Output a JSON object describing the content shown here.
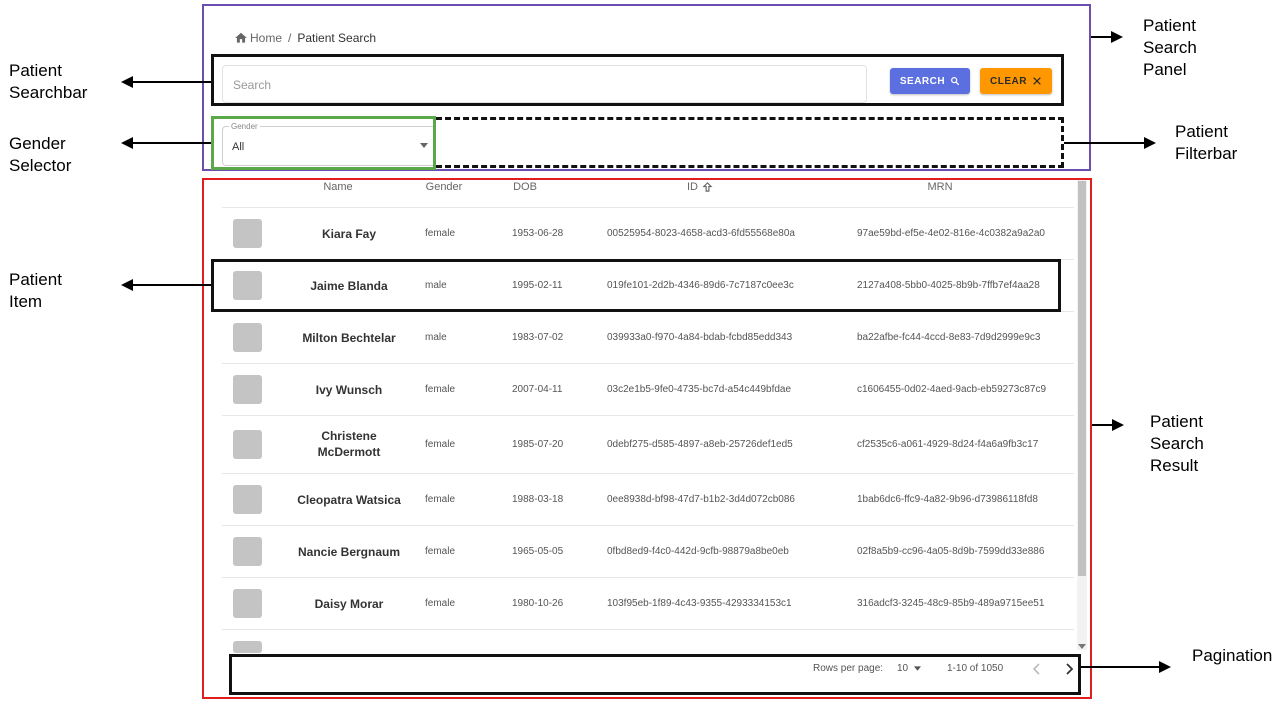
{
  "breadcrumb": {
    "home": "Home",
    "separator": "/",
    "current": "Patient Search"
  },
  "search": {
    "placeholder": "Search",
    "search_label": "SEARCH",
    "clear_label": "CLEAR"
  },
  "gender": {
    "label": "Gender",
    "value": "All"
  },
  "table": {
    "headers": {
      "name": "Name",
      "gender": "Gender",
      "dob": "DOB",
      "id": "ID",
      "mrn": "MRN"
    },
    "rows": [
      {
        "name": "Kiara Fay",
        "gender": "female",
        "dob": "1953-06-28",
        "id": "00525954-8023-4658-acd3-6fd55568e80a",
        "mrn": "97ae59bd-ef5e-4e02-816e-4c0382a9a2a0"
      },
      {
        "name": "Jaime Blanda",
        "gender": "male",
        "dob": "1995-02-11",
        "id": "019fe101-2d2b-4346-89d6-7c7187c0ee3c",
        "mrn": "2127a408-5bb0-4025-8b9b-7ffb7ef4aa28"
      },
      {
        "name": "Milton Bechtelar",
        "gender": "male",
        "dob": "1983-07-02",
        "id": "039933a0-f970-4a84-bdab-fcbd85edd343",
        "mrn": "ba22afbe-fc44-4ccd-8e83-7d9d2999e9c3"
      },
      {
        "name": "Ivy Wunsch",
        "gender": "female",
        "dob": "2007-04-11",
        "id": "03c2e1b5-9fe0-4735-bc7d-a54c449bfdae",
        "mrn": "c1606455-0d02-4aed-9acb-eb59273c87c9"
      },
      {
        "name": "Christene McDermott",
        "gender": "female",
        "dob": "1985-07-20",
        "id": "0debf275-d585-4897-a8eb-25726def1ed5",
        "mrn": "cf2535c6-a061-4929-8d24-f4a6a9fb3c17"
      },
      {
        "name": "Cleopatra Watsica",
        "gender": "female",
        "dob": "1988-03-18",
        "id": "0ee8938d-bf98-47d7-b1b2-3d4d072cb086",
        "mrn": "1bab6dc6-ffc9-4a82-9b96-d73986118fd8"
      },
      {
        "name": "Nancie Bergnaum",
        "gender": "female",
        "dob": "1965-05-05",
        "id": "0fbd8ed9-f4c0-442d-9cfb-98879a8be0eb",
        "mrn": "02f8a5b9-cc96-4a05-8d9b-7599dd33e886"
      },
      {
        "name": "Daisy Morar",
        "gender": "female",
        "dob": "1980-10-26",
        "id": "103f95eb-1f89-4c43-9355-4293334153c1",
        "mrn": "316adcf3-3245-48c9-85b9-489a9715ee51"
      }
    ]
  },
  "pagination": {
    "rows_per_page_label": "Rows per page:",
    "rows_per_page": "10",
    "range": "1-10 of 1050"
  },
  "annotations": {
    "patient_search_panel": "Patient Search Panel",
    "patient_searchbar": "Patient Searchbar",
    "gender_selector": "Gender Selector",
    "patient_filterbar": "Patient Filterbar",
    "patient_item": "Patient Item",
    "patient_search_result": "Patient Search Result",
    "pagination": "Pagination"
  },
  "colors": {
    "search_button": "#5b6fe0",
    "clear_button": "#ff9800",
    "panel_outline": "#6a4fb0",
    "result_outline": "#e11d1d",
    "gender_outline": "#5aa84a"
  }
}
